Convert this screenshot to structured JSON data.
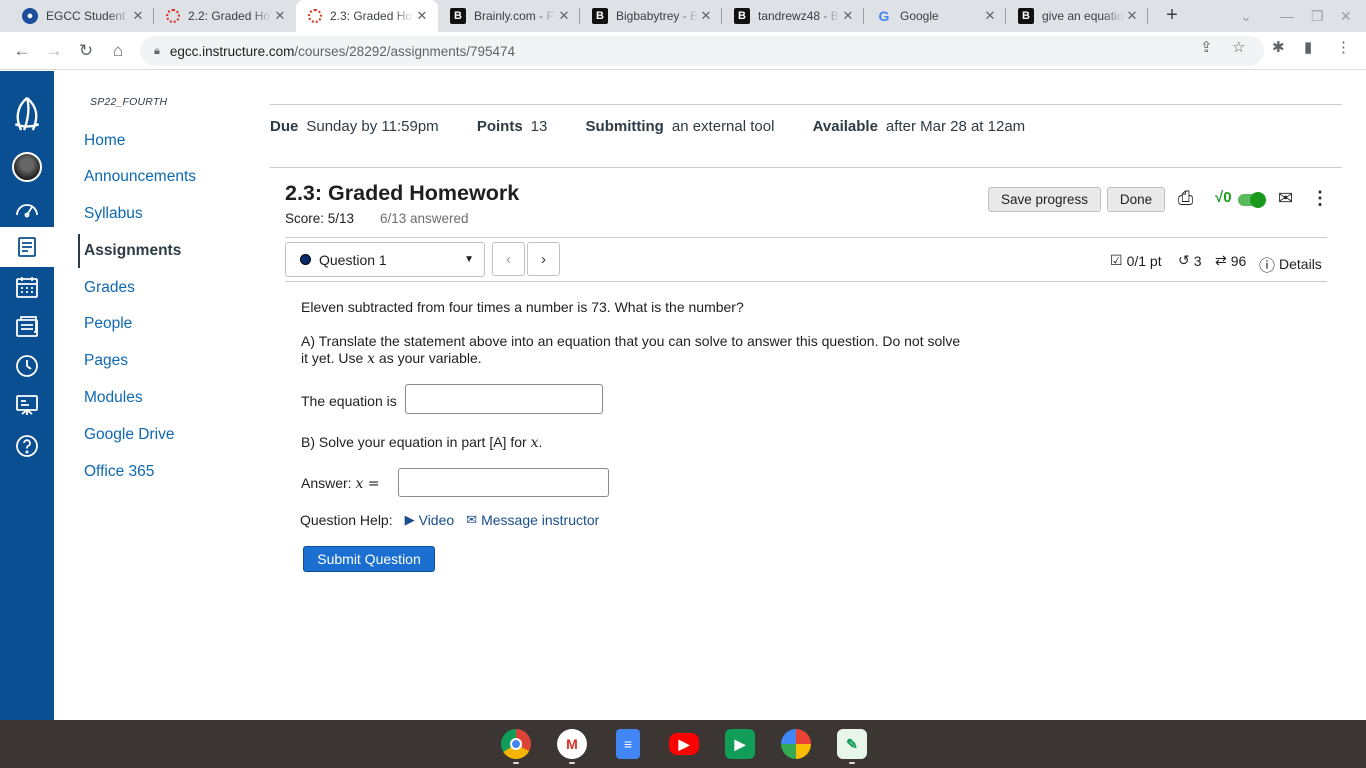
{
  "browser": {
    "tabs": [
      {
        "title": "EGCC Student",
        "fav": "canvas-icon",
        "active": false
      },
      {
        "title": "2.2: Graded Ho",
        "fav": "ring-icon",
        "active": false
      },
      {
        "title": "2.3: Graded Ho",
        "fav": "ring-icon",
        "active": true
      },
      {
        "title": "Brainly.com - F",
        "fav": "brainly-icon",
        "active": false
      },
      {
        "title": "Bigbabytrey - B",
        "fav": "brainly-icon",
        "active": false
      },
      {
        "title": "tandrewz48 - B",
        "fav": "brainly-icon",
        "active": false
      },
      {
        "title": "Google",
        "fav": "google-icon",
        "active": false
      },
      {
        "title": "give an equatio",
        "fav": "brainly-icon",
        "active": false
      }
    ],
    "url_host": "egcc.instructure.com",
    "url_path": "/courses/28292/assignments/795474"
  },
  "course": {
    "code": "SP22_FOURTH",
    "nav": [
      "Home",
      "Announcements",
      "Syllabus",
      "Assignments",
      "Grades",
      "People",
      "Pages",
      "Modules",
      "Google Drive",
      "Office 365"
    ]
  },
  "assignment": {
    "due_label": "Due",
    "due_value": "Sunday by 11:59pm",
    "points_label": "Points",
    "points_value": "13",
    "submitting_label": "Submitting",
    "submitting_value": "an external tool",
    "available_label": "Available",
    "available_value": "after Mar 28 at 12am"
  },
  "homework": {
    "title": "2.3: Graded Homework",
    "score": "Score: 5/13",
    "answered": "6/13 answered",
    "save_label": "Save progress",
    "done_label": "Done",
    "question_select": "Question 1",
    "pts": "0/1 pt",
    "retries": "3",
    "attempts": "96",
    "details": "Details"
  },
  "question": {
    "prompt": "Eleven subtracted from four times a number is 73. What is the number?",
    "partA_1": "A) Translate the statement above into an equation that you can solve to answer this question. Do not solve",
    "partA_2a": "it yet. Use ",
    "partA_var": "x",
    "partA_2b": " as your variable.",
    "equation_label": "The equation is",
    "partB_a": "B) Solve your equation in part [A] for ",
    "partB_var": "x",
    "partB_b": ".",
    "answer_label": "Answer: ",
    "answer_var": "x",
    "answer_eq": " =",
    "help_label": "Question Help:",
    "video_label": "Video",
    "message_label": "Message instructor",
    "submit_label": "Submit Question"
  },
  "colors": {
    "canvas_nav": "#0a4f91",
    "link": "#0e68b3",
    "submit": "#1a6fd1"
  }
}
